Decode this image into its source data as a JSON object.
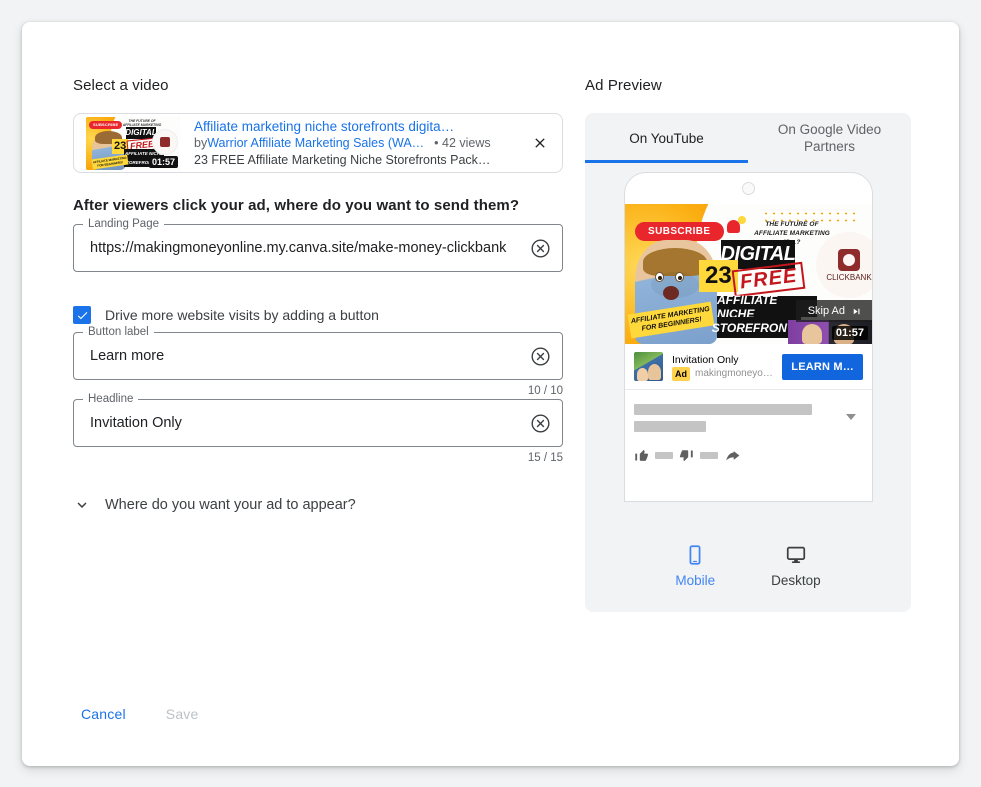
{
  "left": {
    "section_title": "Select a video",
    "video_card": {
      "title": "Affiliate marketing niche storefronts digita…",
      "by_prefix": "by ",
      "channel": "Warrior Affiliate Marketing Sales (WA…",
      "views": "• 42 views",
      "description": "23 FREE Affiliate Marketing Niche Storefronts Pack…",
      "duration": "01:57",
      "thumbnail": {
        "subscribe": "SUBSCRIBE",
        "tagline": "THE FUTURE OF AFFILIATE MARKETING IS…?",
        "word_digital": "DIGITAL",
        "number": "23",
        "word_free": "FREE",
        "line_affiliate": "AFFILIATE NICHE",
        "line_storefronts": "STOREFRONTS!",
        "brand": "CLICKBANK",
        "banner": "AFFILIATE MARKETING FOR BEGINNERS!"
      },
      "remove_label": "✕"
    },
    "prompt_heading": "After viewers click your ad, where do you want to send them?",
    "landing_page": {
      "label": "Landing Page",
      "value": "https://makingmoneyonline.my.canva.site/make-money-clickbank",
      "placeholder": "Landing Page"
    },
    "drive_visits_checkbox": {
      "label": "Drive more website visits by adding a button",
      "checked": true
    },
    "button_label_field": {
      "label": "Button label",
      "value": "Learn more",
      "placeholder": "Button label",
      "counter": "10 / 10"
    },
    "headline_field": {
      "label": "Headline",
      "value": "Invitation Only",
      "placeholder": "Headline",
      "counter": "15 / 15"
    },
    "expander_label": "Where do you want your ad to appear?",
    "cancel_label": "Cancel",
    "save_label": "Save"
  },
  "right": {
    "section_title": "Ad Preview",
    "tabs": [
      {
        "label": "On YouTube",
        "active": true
      },
      {
        "label": "On Google Video Partners",
        "active": false
      }
    ],
    "player": {
      "skip_label": "Skip Ad",
      "duration": "01:57"
    },
    "ad_row": {
      "headline": "Invitation Only",
      "badge": "Ad",
      "url": "makingmoneyonline....",
      "cta": "LEARN M…"
    },
    "devices": [
      {
        "label": "Mobile",
        "icon": "mobile-icon",
        "active": true
      },
      {
        "label": "Desktop",
        "icon": "desktop-icon",
        "active": false
      }
    ]
  },
  "colors": {
    "accent": "#1a73e8",
    "panel_bg": "#f1f3f4",
    "text_primary": "#202124",
    "text_secondary": "#5f6368",
    "cta_blue": "#1266dd",
    "ad_badge": "#ffd24d"
  }
}
